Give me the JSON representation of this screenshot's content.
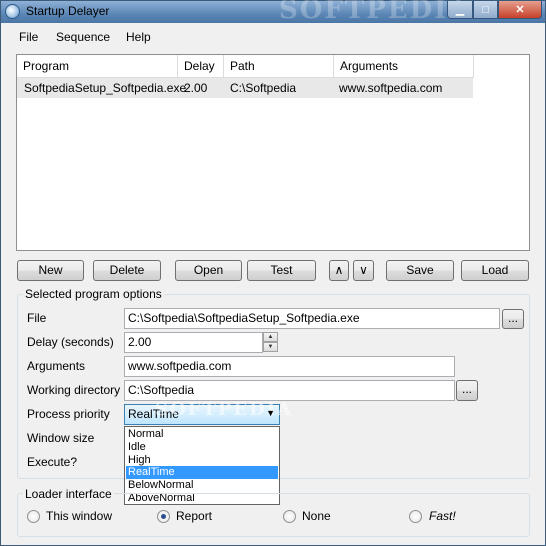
{
  "window": {
    "title": "Startup Delayer",
    "watermark": "SOFTPEDIA"
  },
  "menu": {
    "file": "File",
    "sequence": "Sequence",
    "help": "Help"
  },
  "list": {
    "columns": [
      "Program",
      "Delay",
      "Path",
      "Arguments"
    ],
    "rows": [
      {
        "program": "SoftpediaSetup_Softpedia.exe",
        "delay": "2.00",
        "path": "C:\\Softpedia",
        "arguments": "www.softpedia.com"
      }
    ]
  },
  "buttons": {
    "new": "New",
    "delete": "Delete",
    "open": "Open",
    "test": "Test",
    "up": "∧",
    "down": "∨",
    "save": "Save",
    "load": "Load",
    "browse": "..."
  },
  "options": {
    "group_label": "Selected program options",
    "file_label": "File",
    "file_value": "C:\\Softpedia\\SoftpediaSetup_Softpedia.exe",
    "delay_label": "Delay (seconds)",
    "delay_value": "2.00",
    "arguments_label": "Arguments",
    "arguments_value": "www.softpedia.com",
    "workdir_label": "Working directory",
    "workdir_value": "C:\\Softpedia",
    "priority_label": "Process priority",
    "priority_value": "RealTime",
    "priority_options": [
      "Normal",
      "Idle",
      "High",
      "RealTime",
      "BelowNormal",
      "AboveNormal"
    ],
    "window_size_label": "Window size",
    "execute_label": "Execute?"
  },
  "loader": {
    "group_label": "Loader interface",
    "options": [
      "This window",
      "Report",
      "None",
      "Fast!"
    ],
    "selected": "Report"
  },
  "icons": {
    "app": "startup-delayer-icon",
    "combo_arrow": "▼",
    "spin_up": "▲",
    "spin_down": "▼"
  }
}
